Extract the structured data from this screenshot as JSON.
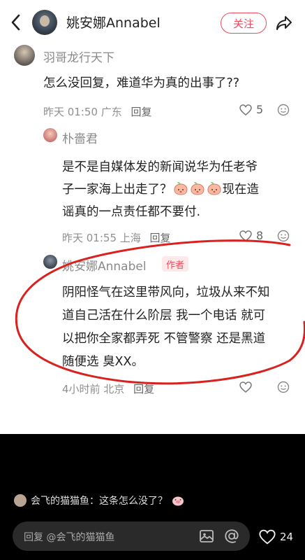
{
  "header": {
    "name": "姚安娜Annabel",
    "follow_label": "关注"
  },
  "comments": [
    {
      "name": "羽哥龙行天下",
      "text": "怎么没回复，难道华为真的出事了??",
      "meta": "昨天 01:50 广东",
      "reply_label": "回复",
      "likes": "5"
    },
    {
      "name": "朴嗇君",
      "text_line1": "是不是自媒体发的新闻说华为任老爷",
      "text_line2a": "子一家海上出走了？",
      "text_line2b": "现在造",
      "text_line3": "谣真的一点责任都不要付.",
      "meta": "昨天 01:55 上海",
      "reply_label": "回复",
      "likes": "8"
    },
    {
      "name": "姚安娜Annabel",
      "author_tag": "作者",
      "text_line1": "阴阳怪气在这里带风向，垃圾从来不知",
      "text_line2": "道自己活在什么阶层 我一个电话 就可",
      "text_line3": "以把你全家都弄死 不管警察 还是黑道",
      "text_line4": "随便选 臭XX。",
      "meta": "4小时前 北京",
      "reply_label": "回复"
    }
  ],
  "notice": {
    "text": "会飞的猫猫鱼：这条怎么没了？"
  },
  "input": {
    "placeholder": "回复 @会飞的猫猫鱼"
  },
  "bottom_likes": "24",
  "colors": {
    "accent": "#f04b5c",
    "circle": "#d9221f"
  }
}
